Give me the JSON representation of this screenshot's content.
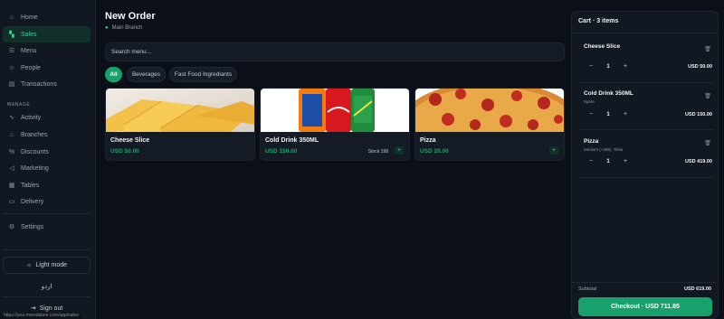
{
  "sidebar": {
    "nav": [
      {
        "label": "Home",
        "icon": "home-icon",
        "glyph": "⌂",
        "active": false
      },
      {
        "label": "Sales",
        "icon": "cart-icon",
        "glyph": "🛒",
        "active": true
      },
      {
        "label": "Menu",
        "icon": "book-icon",
        "glyph": "☰",
        "active": false
      },
      {
        "label": "People",
        "icon": "people-icon",
        "glyph": "☺",
        "active": false
      },
      {
        "label": "Transactions",
        "icon": "receipt-icon",
        "glyph": "▤",
        "active": false
      }
    ],
    "manage_label": "MANAGE",
    "manage": [
      {
        "label": "Activity",
        "icon": "activity-icon",
        "glyph": "∿"
      },
      {
        "label": "Branches",
        "icon": "branch-icon",
        "glyph": "⌂"
      },
      {
        "label": "Discounts",
        "icon": "percent-icon",
        "glyph": "%"
      },
      {
        "label": "Marketing",
        "icon": "megaphone-icon",
        "glyph": "◁"
      },
      {
        "label": "Tables",
        "icon": "table-icon",
        "glyph": "▦"
      },
      {
        "label": "Delivery",
        "icon": "truck-icon",
        "glyph": "▭"
      }
    ],
    "settings_label": "Settings",
    "light_mode_label": "Light mode",
    "language_label": "اردو",
    "sign_out_label": "Sign out",
    "status_url": "https://pos.moredukes.com/app/sales"
  },
  "header": {
    "title": "New Order",
    "branch": "Main Branch"
  },
  "search": {
    "placeholder": "Search menu..."
  },
  "filters": [
    "All",
    "Beverages",
    "Fast Food Ingrediants"
  ],
  "products": [
    {
      "name": "Cheese Slice",
      "price": "USD 50.00",
      "stock": "",
      "add_label": "+"
    },
    {
      "name": "Cold Drink 350ML",
      "price": "USD 150.00",
      "stock": "Stock 198",
      "add_label": "+"
    },
    {
      "name": "Pizza",
      "price": "USD 20.00",
      "stock": "",
      "add_label": "+"
    }
  ],
  "cart": {
    "title": "Cart · 3 items",
    "items": [
      {
        "name": "Cheese Slice",
        "sub": "",
        "qty": "1",
        "total": "USD 50.00"
      },
      {
        "name": "Cold Drink 350ML",
        "sub": "Sprite",
        "qty": "1",
        "total": "USD 150.00"
      },
      {
        "name": "Pizza",
        "sub": "Medium (+399), Tikka",
        "qty": "1",
        "total": "USD 419.00"
      }
    ],
    "subtotal_label": "Subtotal",
    "subtotal_value": "USD 619.00",
    "checkout_label": "Checkout · USD 711.85"
  },
  "colors": {
    "accent": "#16a36b",
    "background": "#0b1018",
    "panel": "#121822"
  }
}
